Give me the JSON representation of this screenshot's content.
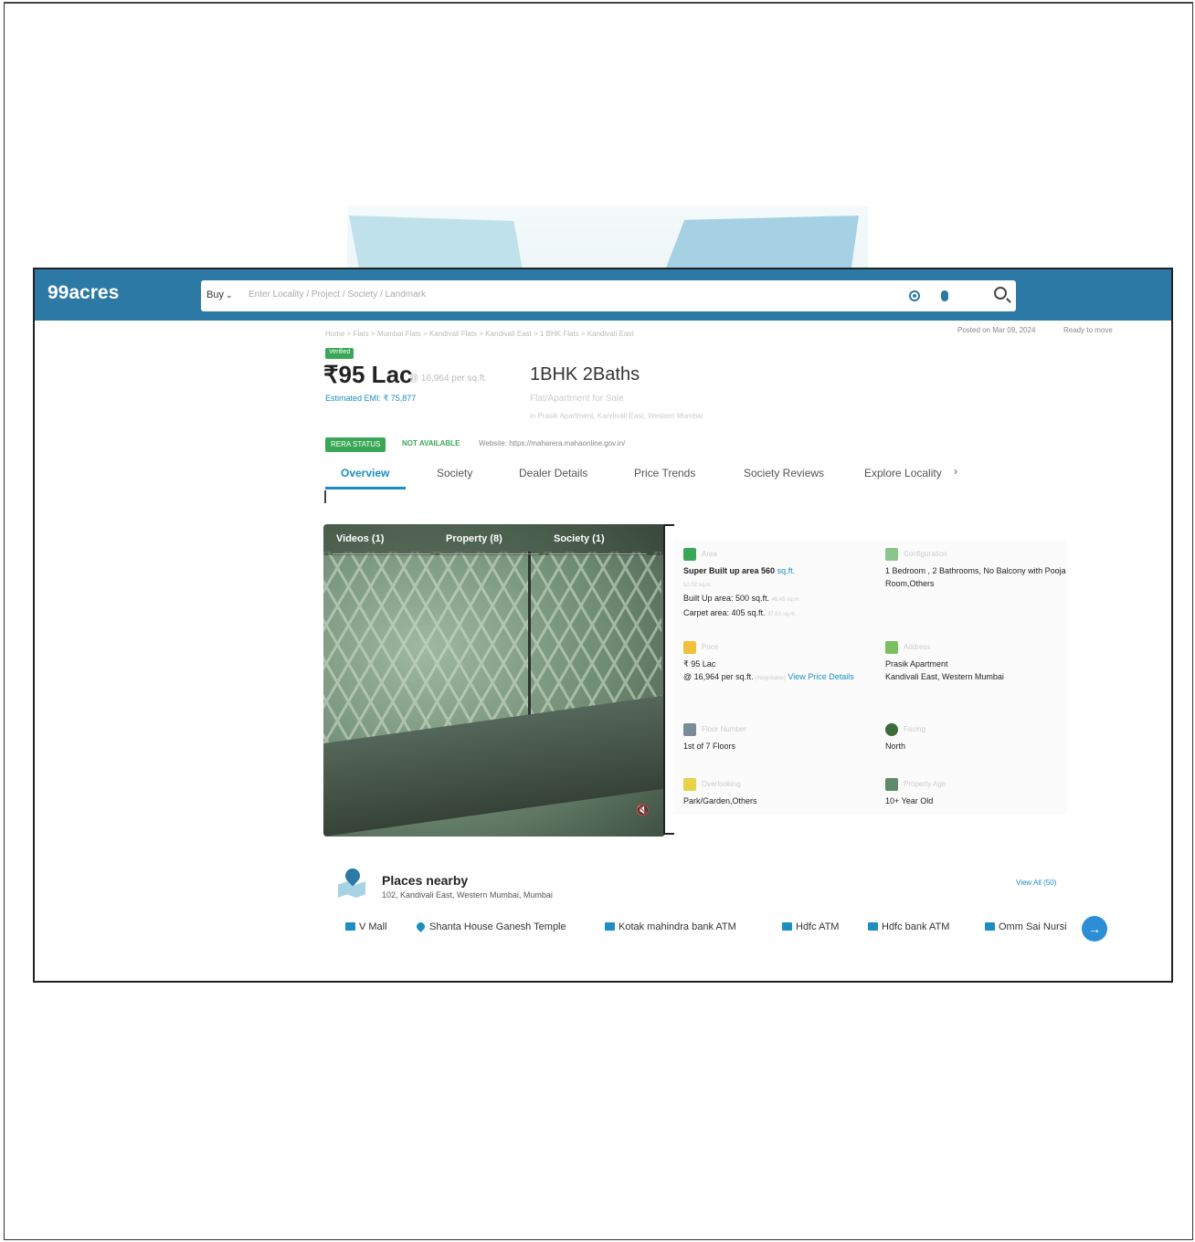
{
  "header": {
    "logo": "99acres",
    "buy_label": "Buy",
    "search_placeholder": "Enter Locality / Project / Society / Landmark"
  },
  "listing": {
    "breadcrumb": "Home > Flats > Mumbai Flats > Kandivali Flats > Kandivali East > 1 BHK Flats > Kandivali East",
    "posted": "Posted on Mar 09, 2024",
    "status": "Ready to move",
    "verified_label": "Verified",
    "price": "₹95 Lac",
    "price_per_sqft": "@ 16,964 per sq.ft.",
    "emi": "Estimated EMI: ₹ 75,877",
    "title": "1BHK 2Baths",
    "subtype": "Flat/Apartment for Sale",
    "address_line": "in Prasik Apartment, Kandivali East, Western Mumbai",
    "rera_label": "RERA STATUS",
    "rera_value": "NOT AVAILABLE",
    "rera_site": "Website: https://maharera.mahaonline.gov.in/"
  },
  "tabs": [
    "Overview",
    "Society",
    "Dealer Details",
    "Price Trends",
    "Society Reviews",
    "Explore Locality"
  ],
  "media": {
    "tabs": [
      "Videos (1)",
      "Property (8)",
      "Society (1)"
    ]
  },
  "details": {
    "area": {
      "label": "Area",
      "line1": "Super Built up area 560",
      "unit": "sq.ft.",
      "sub1": "52.02 sq.m.",
      "line2": "Built Up area: 500 sq.ft.",
      "sub2": "46.45 sq.m.",
      "line3": "Carpet area: 405 sq.ft.",
      "sub3": "37.63 sq.m."
    },
    "configuration": {
      "label": "Configuration",
      "value": "1 Bedroom , 2 Bathrooms, No Balcony with Pooja Room,Others"
    },
    "price": {
      "label": "Price",
      "value": "₹ 95 Lac",
      "per": "@ 16,964 per sq.ft.",
      "negotiable": "(Negotiable)",
      "link": "View Price Details"
    },
    "address": {
      "label": "Address",
      "line1": "Prasik Apartment",
      "line2": "Kandivali East, Western Mumbai"
    },
    "floor": {
      "label": "Floor Number",
      "value": "1st of 7 Floors"
    },
    "facing": {
      "label": "Facing",
      "value": "North"
    },
    "overlooking": {
      "label": "Overlooking",
      "value": "Park/Garden,Others"
    },
    "age": {
      "label": "Property Age",
      "value": "10+ Year Old"
    }
  },
  "places": {
    "title": "Places nearby",
    "address": "102, Kandivali East, Western Mumbai, Mumbai",
    "view_all": "View All (50)",
    "items": [
      "V Mall",
      "Shanta House Ganesh Temple",
      "Kotak mahindra bank ATM",
      "Hdfc ATM",
      "Hdfc bank ATM",
      "Omm Sai Nursi"
    ]
  },
  "colors": {
    "brand": "#2c79a6",
    "link": "#1d8ec2",
    "success": "#3aa757"
  }
}
